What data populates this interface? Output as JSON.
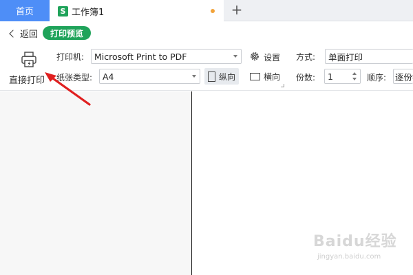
{
  "tabs": {
    "home_label": "首页",
    "workbook_icon": "S",
    "workbook_label": "工作簿1",
    "add_label": "+"
  },
  "nav": {
    "back_label": "返回",
    "preview_label": "打印预览"
  },
  "toolbar": {
    "direct_print_label": "直接打印",
    "printer_label": "打印机:",
    "printer_value": "Microsoft Print to PDF",
    "settings_label": "设置",
    "mode_label": "方式:",
    "mode_value": "单面打印",
    "paper_label": "纸张类型:",
    "paper_value": "A4",
    "portrait_label": "纵向",
    "landscape_label": "横向",
    "copies_label": "份数:",
    "copies_value": "1",
    "order_label": "顺序:",
    "order_value": "逐份打"
  },
  "watermark": {
    "logo_text": "Baidu经验",
    "url_text": "jingyan.baidu.com"
  },
  "colors": {
    "tab_active": "#4e8ef7",
    "accent_green": "#1fa35a",
    "annotation_red": "#e02020",
    "modified_dot": "#f2a33a"
  },
  "icons": [
    "printer-icon",
    "gear-icon",
    "portrait-page-icon",
    "landscape-page-icon",
    "back-chevron-icon"
  ]
}
